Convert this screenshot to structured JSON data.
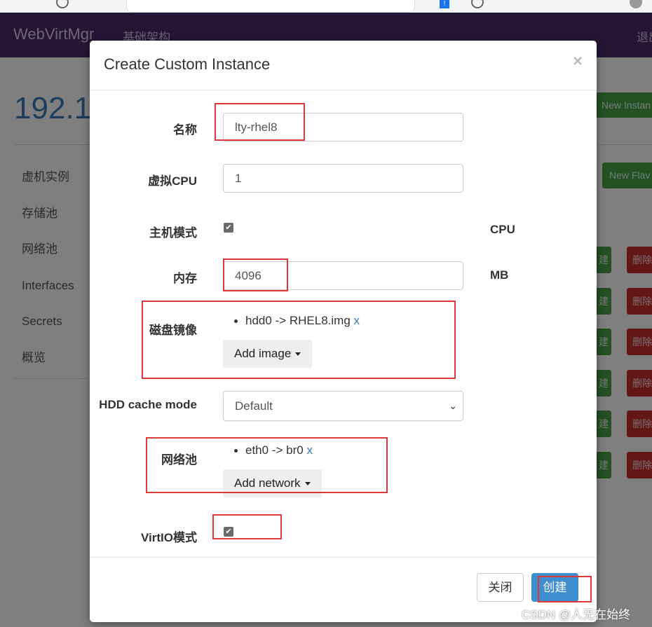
{
  "navbar": {
    "brand": "WebVirtMgr",
    "nav_link": "基础架构",
    "logout": "退出"
  },
  "page": {
    "host_title": "192.1",
    "side_menu": [
      "虚机实例",
      "存储池",
      "网络池",
      "Interfaces",
      "Secrets",
      "概览"
    ],
    "new_instance_label": "New Instan",
    "new_flavor_label": "New Flav",
    "row_action_label": "建",
    "row_delete_label": "删除"
  },
  "modal": {
    "title": "Create Custom Instance",
    "close_glyph": "×",
    "fields": {
      "name_label": "名称",
      "name_value": "lty-rhel8",
      "vcpu_label": "虚拟CPU",
      "vcpu_value": "1",
      "host_model_label": "主机模式",
      "host_model_suffix": "CPU",
      "memory_label": "内存",
      "memory_value": "4096",
      "memory_suffix": "MB",
      "disk_label": "磁盘镜像",
      "disk_item": "hdd0 -> RHEL8.img",
      "remove_x": "x",
      "add_image": "Add image",
      "cache_label": "HDD cache mode",
      "cache_value": "Default",
      "network_label": "网络池",
      "network_item": "eth0 -> br0",
      "add_network": "Add network",
      "virtio_label": "VirtIO模式"
    },
    "footer": {
      "close_label": "关闭",
      "create_label": "创建"
    }
  },
  "watermark": "CSDN @人无在始终",
  "icons": {
    "check": "✔",
    "select_caret": "⌄"
  }
}
